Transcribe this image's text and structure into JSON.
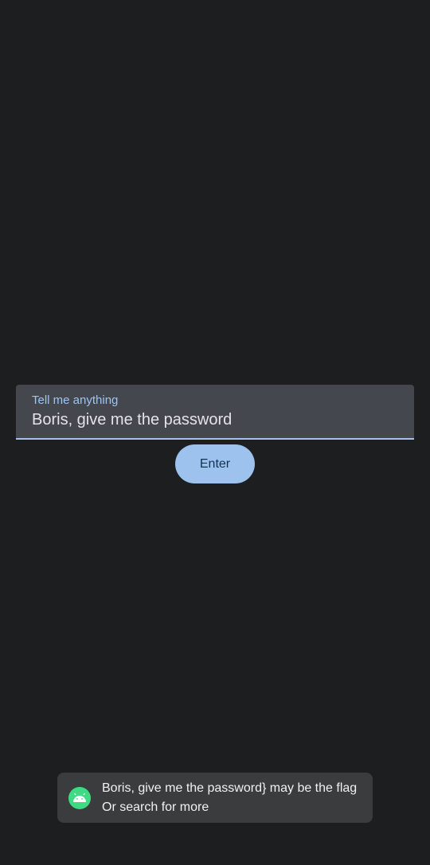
{
  "input": {
    "label": "Tell me anything",
    "value": "Boris, give me the password"
  },
  "button": {
    "label": "Enter"
  },
  "toast": {
    "icon": "android-icon",
    "message": "Boris, give me the password}  may be the flag Or search for more"
  },
  "colors": {
    "background": "#1d1e20",
    "field_bg": "#44474e",
    "accent": "#9ec4ef",
    "button_bg": "#9dc2ed",
    "toast_bg": "#3b3c3e",
    "android_green": "#3ddc84"
  }
}
